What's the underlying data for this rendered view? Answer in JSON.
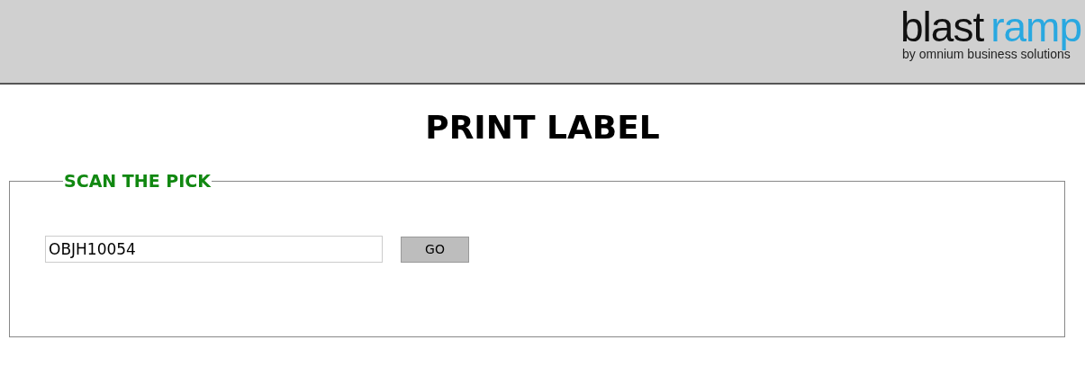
{
  "header": {
    "logo": {
      "brand_dark": "blast",
      "brand_accent": "ramp",
      "tagline": "by omnium business solutions"
    }
  },
  "page_title": "PRINT LABEL",
  "scan_section": {
    "legend": "SCAN THE PICK",
    "input": {
      "value": "OBJH10054"
    },
    "button": "GO"
  }
}
